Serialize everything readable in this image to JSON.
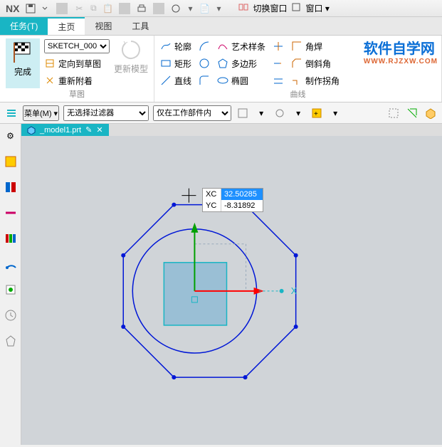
{
  "app": {
    "logo": "NX"
  },
  "qat": {
    "switch_window": "切换窗口",
    "window_menu": "窗口"
  },
  "tabs": {
    "task": "任务(T)",
    "home": "主页",
    "view": "视图",
    "tools": "工具"
  },
  "ribbon": {
    "finish": "完成",
    "sketch_select": "SKETCH_000",
    "orient": "定向到草图",
    "reattach": "重新附着",
    "update": "更新模型",
    "group1": "草图",
    "profile": "轮廓",
    "rect": "矩形",
    "line": "直线",
    "art": "艺术样条",
    "polygon": "多边形",
    "ellipse": "椭圆",
    "corner": "角焊",
    "chamfer": "倒斜角",
    "makecorner": "制作拐角",
    "group2": "曲线"
  },
  "watermark": {
    "main": "软件自学网",
    "sub": "WWW.RJZXW.COM"
  },
  "filter": {
    "menu": "菜单(M)",
    "nofilter": "无选择过滤器",
    "workpart": "仅在工作部件内"
  },
  "filetab": {
    "name": "_model1.prt",
    "mod": "✎",
    "close": "✕"
  },
  "dyn": {
    "xc_label": "XC",
    "xc_val": "32.50285",
    "yc_label": "YC",
    "yc_val": "-8.31892"
  },
  "axis": {
    "x": "X"
  }
}
